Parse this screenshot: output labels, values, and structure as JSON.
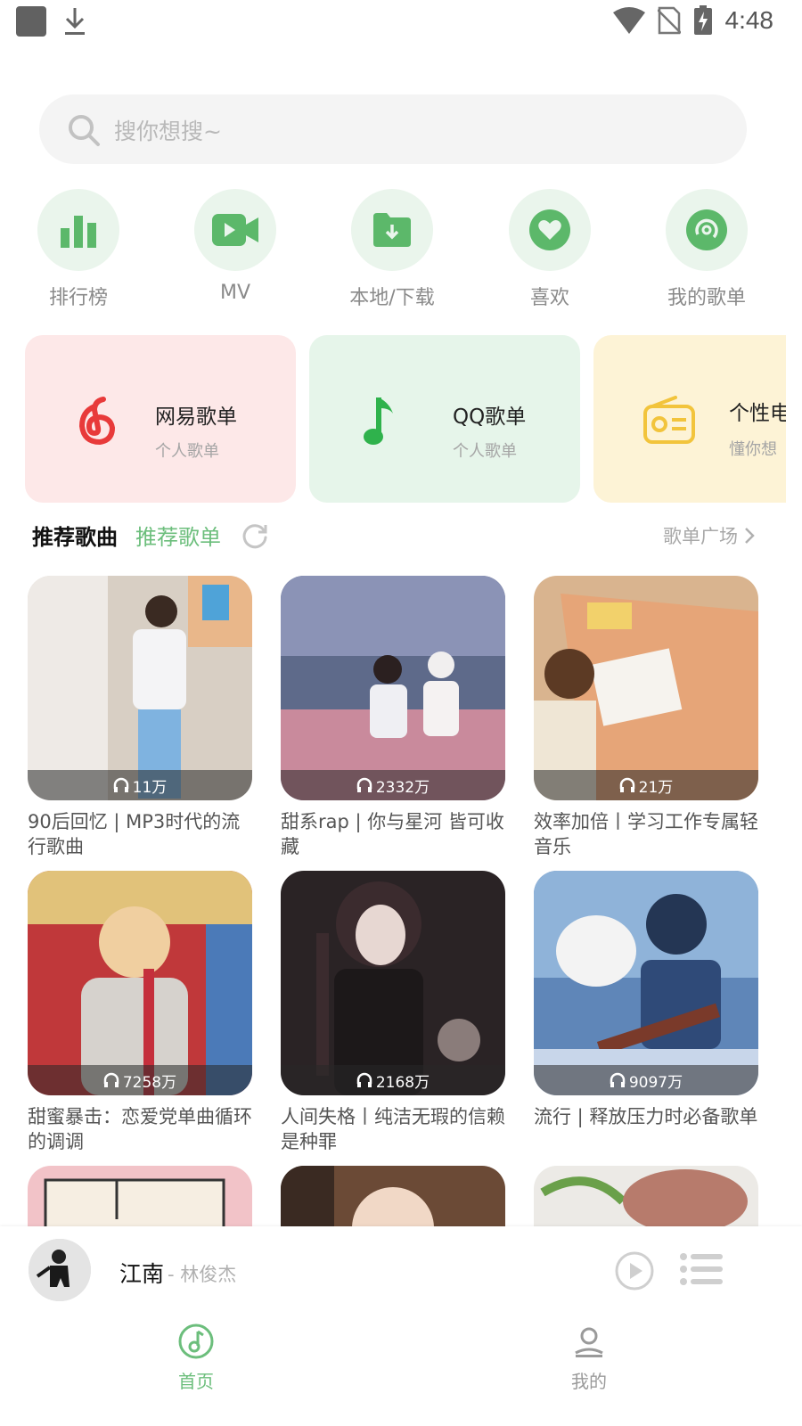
{
  "status_bar": {
    "time": "4:48"
  },
  "search": {
    "placeholder": "搜你想搜~"
  },
  "quick_entries": [
    {
      "label": "排行榜",
      "icon": "chart-icon"
    },
    {
      "label": "MV",
      "icon": "video-icon"
    },
    {
      "label": "本地/下载",
      "icon": "download-folder-icon"
    },
    {
      "label": "喜欢",
      "icon": "heart-icon"
    },
    {
      "label": "我的歌单",
      "icon": "playlist-disc-icon"
    }
  ],
  "source_cards": [
    {
      "title": "网易歌单",
      "subtitle": "个人歌单",
      "icon": "netease-icon",
      "bg": "#fde8e8"
    },
    {
      "title": "QQ歌单",
      "subtitle": "个人歌单",
      "icon": "qq-music-note-icon",
      "bg": "#e6f5ea"
    },
    {
      "title": "个性电",
      "subtitle": "懂你想",
      "icon": "radio-icon",
      "bg": "#fdf3d6"
    }
  ],
  "tabs": {
    "active": "推荐歌曲",
    "second": "推荐歌单"
  },
  "square_link": "歌单广场",
  "playlists": [
    {
      "count": "11万",
      "title": "90后回忆 | MP3时代的流行歌曲"
    },
    {
      "count": "2332万",
      "title": "甜系rap | 你与星河 皆可收藏"
    },
    {
      "count": "21万",
      "title": "效率加倍丨学习工作专属轻音乐"
    },
    {
      "count": "7258万",
      "title": "甜蜜暴击：恋爱党单曲循环的调调"
    },
    {
      "count": "2168万",
      "title": "人间失格丨纯洁无瑕的信赖是种罪"
    },
    {
      "count": "9097万",
      "title": "流行 | 释放压力时必备歌单"
    }
  ],
  "player": {
    "title": "江南",
    "artist": "- 林俊杰"
  },
  "nav": {
    "home": "首页",
    "mine": "我的"
  },
  "colors": {
    "accent": "#6cbe7c",
    "accent_dark": "#4caf50",
    "icon_bg": "#eaf5ec"
  }
}
